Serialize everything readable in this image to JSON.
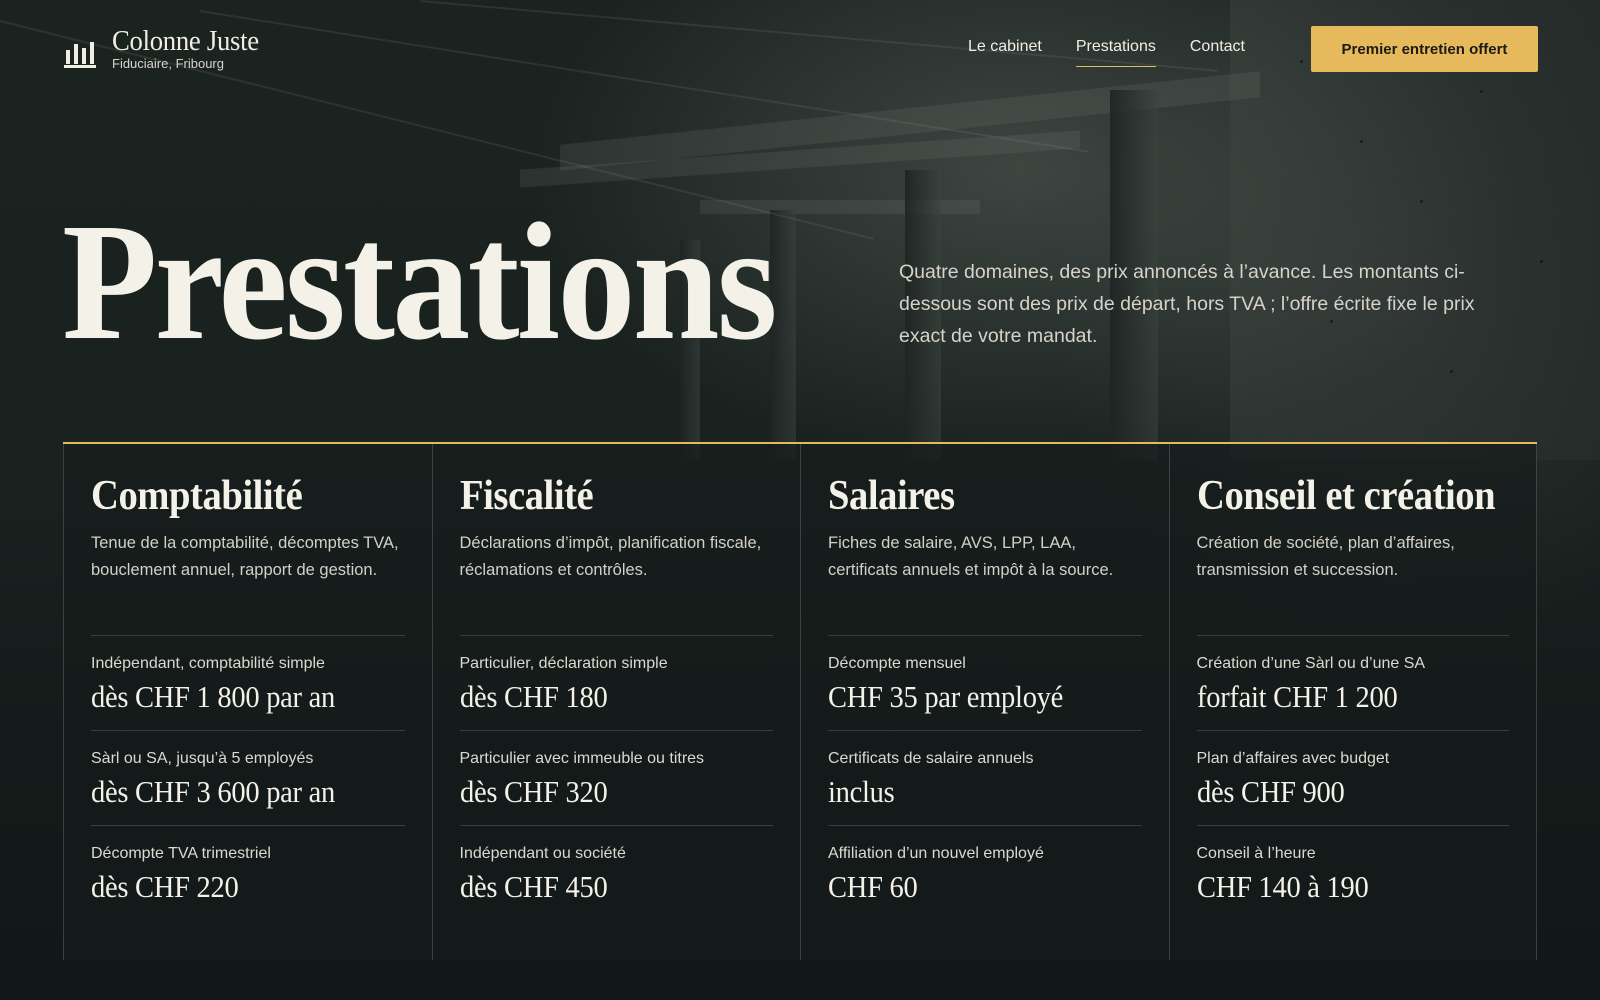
{
  "brand": {
    "name": "Colonne Juste",
    "subtitle": "Fiduciaire, Fribourg"
  },
  "nav": {
    "items": [
      {
        "label": "Le cabinet",
        "active": false
      },
      {
        "label": "Prestations",
        "active": true
      },
      {
        "label": "Contact",
        "active": false
      }
    ],
    "cta_label": "Premier entretien offert"
  },
  "hero": {
    "title": "Prestations",
    "description": "Quatre domaines, des prix annoncés à l’avance. Les montants ci-dessous sont des prix de départ, hors TVA ; l’offre écrite fixe le prix exact de votre mandat."
  },
  "services": [
    {
      "title": "Comptabilité",
      "description": "Tenue de la comptabilité, décomptes TVA, bouclement annuel, rapport de gestion.",
      "prices": [
        {
          "label": "Indépendant, comptabilité simple",
          "value": "dès CHF 1 800 par an"
        },
        {
          "label": "Sàrl ou SA, jusqu’à 5 employés",
          "value": "dès CHF 3 600 par an"
        },
        {
          "label": "Décompte TVA trimestriel",
          "value": "dès CHF 220"
        }
      ]
    },
    {
      "title": "Fiscalité",
      "description": "Déclarations d’impôt, planification fiscale, réclamations et contrôles.",
      "prices": [
        {
          "label": "Particulier, déclaration simple",
          "value": "dès CHF 180"
        },
        {
          "label": "Particulier avec immeuble ou titres",
          "value": "dès CHF 320"
        },
        {
          "label": "Indépendant ou société",
          "value": "dès CHF 450"
        }
      ]
    },
    {
      "title": "Salaires",
      "description": "Fiches de salaire, AVS, LPP, LAA, certificats annuels et impôt à la source.",
      "prices": [
        {
          "label": "Décompte mensuel",
          "value": "CHF 35 par employé"
        },
        {
          "label": "Certificats de salaire annuels",
          "value": "inclus"
        },
        {
          "label": "Affiliation d’un nouvel employé",
          "value": "CHF 60"
        }
      ]
    },
    {
      "title": "Conseil et création",
      "description": "Création de société, plan d’affaires, transmission et succession.",
      "prices": [
        {
          "label": "Création d’une Sàrl ou d’une SA",
          "value": "forfait CHF 1 200"
        },
        {
          "label": "Plan d’affaires avec budget",
          "value": "dès CHF 900"
        },
        {
          "label": "Conseil à l’heure",
          "value": "CHF 140 à 190"
        }
      ]
    }
  ],
  "colors": {
    "accent": "#e6b95c",
    "background": "#141a19",
    "text": "#f4f1e8"
  }
}
